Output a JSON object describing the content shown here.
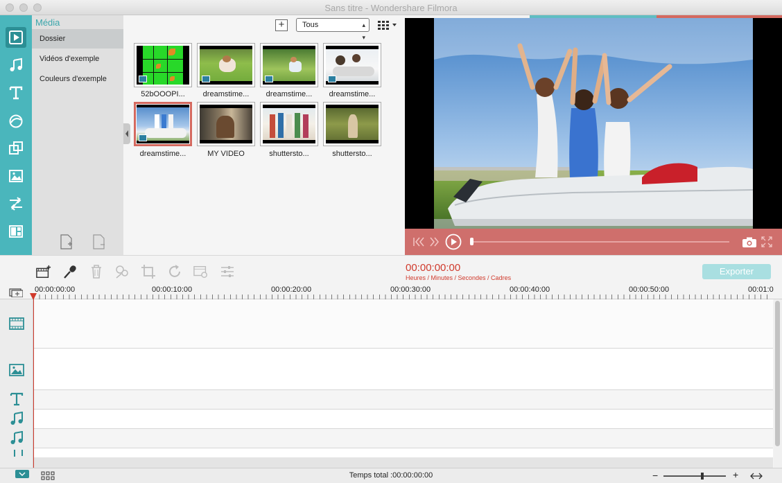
{
  "window": {
    "title": "Sans titre - Wondershare Filmora"
  },
  "sidebar": {
    "header": "Média",
    "items": [
      {
        "label": "Dossier"
      },
      {
        "label": "Vidéos d'exemple"
      },
      {
        "label": "Couleurs d'exemple"
      }
    ]
  },
  "library": {
    "filter": "Tous",
    "items": [
      {
        "caption": "52bOOOPI..."
      },
      {
        "caption": "dreamstime..."
      },
      {
        "caption": "dreamstime..."
      },
      {
        "caption": "dreamstime..."
      },
      {
        "caption": "dreamstime..."
      },
      {
        "caption": "MY VIDEO"
      },
      {
        "caption": "shuttersto..."
      },
      {
        "caption": "shuttersto..."
      }
    ]
  },
  "preview": {
    "progress": 0
  },
  "toolbar": {
    "timecode": "00:00:00:00",
    "timecode_legend": "Heures / Minutes / Secondes / Cadres",
    "export_label": "Exporter"
  },
  "timeline": {
    "ruler_labels": [
      "00:00:00:00",
      "00:00:10:00",
      "00:00:20:00",
      "00:00:30:00",
      "00:00:40:00",
      "00:00:50:00",
      "00:01:0"
    ]
  },
  "status": {
    "total_time": "Temps total :00:00:00:00",
    "zoom_minus": "−",
    "zoom_plus": "+"
  },
  "colors": {
    "accent": "#4ab6bc",
    "timecode": "#d03a2c",
    "preview_bar": "#cf6f6c",
    "export_button": "#a9dfe1"
  }
}
